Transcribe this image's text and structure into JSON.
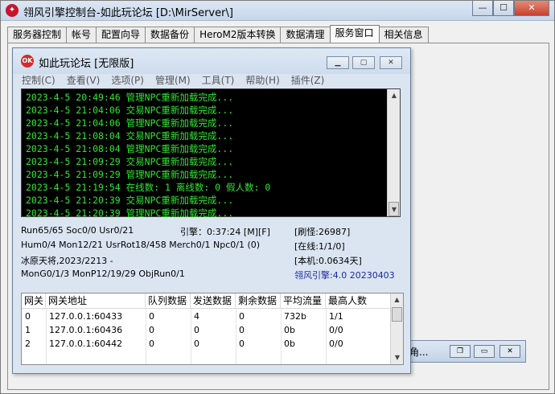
{
  "outer_window": {
    "title": "翎风引擎控制台-如此玩论坛 [D:\\MirServer\\]",
    "controls": {
      "minimize": "—",
      "maximize": "☐",
      "close": "✕"
    }
  },
  "tabs": [
    {
      "label": "服务器控制",
      "active": false
    },
    {
      "label": "帐号",
      "active": false
    },
    {
      "label": "配置向导",
      "active": false
    },
    {
      "label": "数据备份",
      "active": false
    },
    {
      "label": "HeroM2版本转换",
      "active": false
    },
    {
      "label": "数据清理",
      "active": false
    },
    {
      "label": "服务窗口",
      "active": true
    },
    {
      "label": "相关信息",
      "active": false
    }
  ],
  "minimized_window": {
    "label": "角..."
  },
  "inner_window": {
    "title": "如此玩论坛 [无限版]",
    "logo_text": "OK",
    "menu": [
      "控制(C)",
      "查看(V)",
      "选项(P)",
      "管理(M)",
      "工具(T)",
      "帮助(H)",
      "插件(Z)"
    ],
    "console_lines": [
      "2023-4-5 20:49:46 管理NPC重新加载完成...",
      "2023-4-5 21:04:06 交易NPC重新加载完成...",
      "2023-4-5 21:04:06 管理NPC重新加载完成...",
      "2023-4-5 21:08:04 交易NPC重新加载完成...",
      "2023-4-5 21:08:04 管理NPC重新加载完成...",
      "2023-4-5 21:09:29 交易NPC重新加载完成...",
      "2023-4-5 21:09:29 管理NPC重新加载完成...",
      "2023-4-5 21:19:54 在线数: 1 离线数: 0 假人数: 0",
      "2023-4-5 21:20:39 交易NPC重新加载完成...",
      "2023-4-5 21:20:39 管理NPC重新加载完成..."
    ],
    "status": {
      "run": "Run65/65 Soc0/0 Usr0/21",
      "engine_time": "引擎：0:37:24 [M][F]",
      "refresh": "[刷怪:26987]",
      "hum": "Hum0/4 Mon12/21 UsrRot18/458 Merch0/1 Npc0/1 (0)",
      "online": "[在线:1/1/0]",
      "server_info": "冰原天将,2023/2213 -",
      "local": "[本机:0.0634天]",
      "mon": "MonG0/1/3 MonP12/19/29 ObjRun0/1",
      "version": "翎风引擎:4.0 20230403"
    },
    "gateway_table": {
      "headers": [
        "网关",
        "网关地址",
        "队列数据",
        "发送数据",
        "剩余数据",
        "平均流量",
        "最高人数"
      ],
      "rows": [
        [
          "0",
          "127.0.0.1:60433",
          "0",
          "4",
          "0",
          "732b",
          "1/1"
        ],
        [
          "1",
          "127.0.0.1:60436",
          "0",
          "0",
          "0",
          "0b",
          "0/0"
        ],
        [
          "2",
          "127.0.0.1:60442",
          "0",
          "0",
          "0",
          "0b",
          "0/0"
        ]
      ]
    }
  },
  "colors": {
    "console_bg": "#000000",
    "console_text": "#2ee82e",
    "version_text": "#1a2a9a"
  }
}
